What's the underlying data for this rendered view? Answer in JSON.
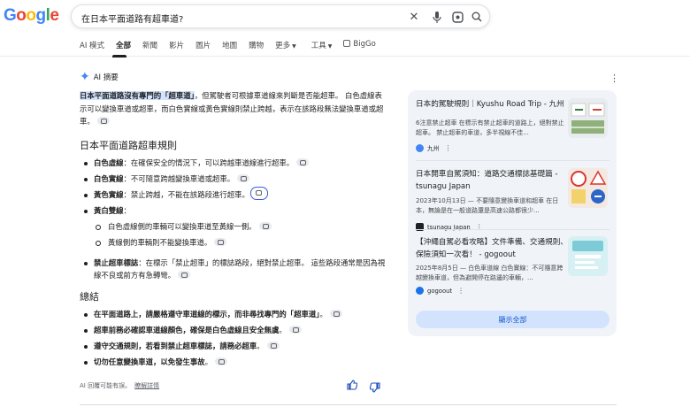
{
  "logo": {
    "letters": [
      "G",
      "o",
      "o",
      "g",
      "l",
      "e"
    ],
    "colors": [
      "#4285f4",
      "#ea4335",
      "#fbbc05",
      "#4285f4",
      "#34a853",
      "#ea4335"
    ]
  },
  "search": {
    "query": "在日本平面道路有超車道?"
  },
  "tabs": [
    {
      "label": "AI 模式"
    },
    {
      "label": "全部"
    },
    {
      "label": "新聞"
    },
    {
      "label": "影片"
    },
    {
      "label": "圖片"
    },
    {
      "label": "地圖"
    },
    {
      "label": "購物"
    },
    {
      "label": "更多"
    },
    {
      "label": "工具"
    },
    {
      "label": "BigGo"
    }
  ],
  "ai": {
    "title": "AI 摘要",
    "intro_hl": "日本平面道路沒有專門的「超車道」",
    "intro_rest": "，但駕駛者可根據車道線來判斷是否能超車。 白色虛線表示可以變換車道或超車，而白色實線或黃色實線則禁止跨越，表示在該路段無法變換車道或超車。",
    "section1": "日本平面道路超車規則",
    "rules": [
      {
        "term": "白色虛線",
        "text": "：在確保安全的情況下，可以跨越車道線進行超車。"
      },
      {
        "term": "白色實線",
        "text": "：不可隨意跨越變換車道或超車。"
      },
      {
        "term": "黃色實線",
        "text": "：禁止跨越，不能在該路段進行超車。"
      },
      {
        "term": "黃白雙線",
        "text": "："
      }
    ],
    "sub_rules": [
      "白色虛線側的車輛可以變換車道至黃線一側。",
      "黃線側的車輛則不能變換車道。"
    ],
    "no_pass": {
      "term": "禁止超車標誌",
      "text": "：在標示「禁止超車」的標誌路段，絕對禁止超車。 這些路段通常是因為視線不良或前方有急轉彎。"
    },
    "section2": "總結",
    "summary": [
      "在平面道路上，請嚴格遵守車道線的標示，而非尋找專門的「超車道」",
      "超車前務必確認車道線顏色，確保是白色虛線且安全無虞",
      "遵守交通規則，若看到禁止超車標誌，請務必超車",
      "切勿任意變換車道，以免發生事故"
    ],
    "summary_tail": [
      "。",
      "。",
      "。",
      "。"
    ],
    "footer": "AI 回覆可能有誤。",
    "footer_link": "瞭解詳情"
  },
  "sources": [
    {
      "title": "日本的駕駛規則｜Kyushu Road Trip - 九州",
      "snippet": "6注意禁止超車 在標示有禁止超車的道路上，絕對禁止超車。 禁止超車的車道，多半視線不佳...",
      "site": "九州",
      "fav": "#4285f4"
    },
    {
      "title": "日本開車自駕須知：道路交通標誌基礎篇 - tsunagu Japan",
      "snippet": "2023年10月13日 — 不要隨意變換車道和超車 在日本，無論是在一般道路還是高速公路都很少...",
      "site": "tsunagu Japan",
      "fav": "#202124"
    },
    {
      "title": "【沖繩自駕必看攻略】文件準備、交通規則、保險須知一次看！ - gogoout",
      "snippet": "2025年8月5日 — 白色車道線 白色實線：不可隨意跨越變換車道，但為避開停在路邊的車輛，...",
      "site": "gogoout",
      "fav": "#1a73e8"
    }
  ],
  "show_all": "顯示全部"
}
